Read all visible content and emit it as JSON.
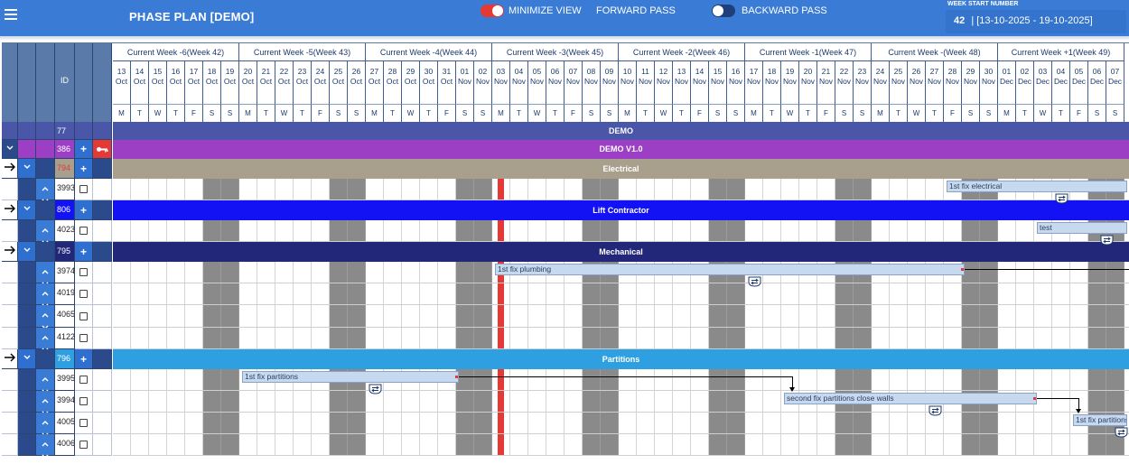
{
  "app": {
    "title": "PHASE PLAN [DEMO]",
    "minimize_label": "MINIMIZE VIEW",
    "forward_label": "FORWARD PASS",
    "backward_label": "BACKWARD PASS",
    "week_start_label": "WEEK START NUMBER",
    "week_number": "42",
    "week_range": "| [13-10-2025 - 19-10-2025]"
  },
  "grid": {
    "id_header": "ID",
    "weeks": [
      {
        "label": "Current Week -6(Week 42)"
      },
      {
        "label": "Current Week -5(Week 43)"
      },
      {
        "label": "Current Week -4(Week 44)"
      },
      {
        "label": "Current Week -3(Week 45)"
      },
      {
        "label": "Current Week -2(Week 46)"
      },
      {
        "label": "Current Week -1(Week 47)"
      },
      {
        "label": "Current Week -(Week 48)"
      },
      {
        "label": "Current Week +1(Week 49)"
      }
    ],
    "days": [
      {
        "d": "13",
        "m": "Oct",
        "w": "M"
      },
      {
        "d": "14",
        "m": "Oct",
        "w": "T"
      },
      {
        "d": "15",
        "m": "Oct",
        "w": "W"
      },
      {
        "d": "16",
        "m": "Oct",
        "w": "T"
      },
      {
        "d": "17",
        "m": "Oct",
        "w": "F"
      },
      {
        "d": "18",
        "m": "Oct",
        "w": "S"
      },
      {
        "d": "19",
        "m": "Oct",
        "w": "S"
      },
      {
        "d": "20",
        "m": "Oct",
        "w": "M"
      },
      {
        "d": "21",
        "m": "Oct",
        "w": "T"
      },
      {
        "d": "22",
        "m": "Oct",
        "w": "W"
      },
      {
        "d": "23",
        "m": "Oct",
        "w": "T"
      },
      {
        "d": "24",
        "m": "Oct",
        "w": "F"
      },
      {
        "d": "25",
        "m": "Oct",
        "w": "S"
      },
      {
        "d": "26",
        "m": "Oct",
        "w": "S"
      },
      {
        "d": "27",
        "m": "Oct",
        "w": "M"
      },
      {
        "d": "28",
        "m": "Oct",
        "w": "T"
      },
      {
        "d": "29",
        "m": "Oct",
        "w": "W"
      },
      {
        "d": "30",
        "m": "Oct",
        "w": "T"
      },
      {
        "d": "31",
        "m": "Oct",
        "w": "F"
      },
      {
        "d": "01",
        "m": "Nov",
        "w": "S"
      },
      {
        "d": "02",
        "m": "Nov",
        "w": "S"
      },
      {
        "d": "03",
        "m": "Nov",
        "w": "M"
      },
      {
        "d": "04",
        "m": "Nov",
        "w": "T"
      },
      {
        "d": "05",
        "m": "Nov",
        "w": "W"
      },
      {
        "d": "06",
        "m": "Nov",
        "w": "T"
      },
      {
        "d": "07",
        "m": "Nov",
        "w": "F"
      },
      {
        "d": "08",
        "m": "Nov",
        "w": "S"
      },
      {
        "d": "09",
        "m": "Nov",
        "w": "S"
      },
      {
        "d": "10",
        "m": "Nov",
        "w": "M"
      },
      {
        "d": "11",
        "m": "Nov",
        "w": "T"
      },
      {
        "d": "12",
        "m": "Nov",
        "w": "W"
      },
      {
        "d": "13",
        "m": "Nov",
        "w": "T"
      },
      {
        "d": "14",
        "m": "Nov",
        "w": "F"
      },
      {
        "d": "15",
        "m": "Nov",
        "w": "S"
      },
      {
        "d": "16",
        "m": "Nov",
        "w": "S"
      },
      {
        "d": "17",
        "m": "Nov",
        "w": "M"
      },
      {
        "d": "18",
        "m": "Nov",
        "w": "T"
      },
      {
        "d": "19",
        "m": "Nov",
        "w": "W"
      },
      {
        "d": "20",
        "m": "Nov",
        "w": "T"
      },
      {
        "d": "21",
        "m": "Nov",
        "w": "F"
      },
      {
        "d": "22",
        "m": "Nov",
        "w": "S"
      },
      {
        "d": "23",
        "m": "Nov",
        "w": "S"
      },
      {
        "d": "24",
        "m": "Nov",
        "w": "M"
      },
      {
        "d": "25",
        "m": "Nov",
        "w": "T"
      },
      {
        "d": "26",
        "m": "Nov",
        "w": "W"
      },
      {
        "d": "27",
        "m": "Nov",
        "w": "T"
      },
      {
        "d": "28",
        "m": "Nov",
        "w": "F"
      },
      {
        "d": "29",
        "m": "Nov",
        "w": "S"
      },
      {
        "d": "30",
        "m": "Nov",
        "w": "S"
      },
      {
        "d": "01",
        "m": "Dec",
        "w": "M"
      },
      {
        "d": "02",
        "m": "Dec",
        "w": "T"
      },
      {
        "d": "03",
        "m": "Dec",
        "w": "W"
      },
      {
        "d": "04",
        "m": "Dec",
        "w": "T"
      },
      {
        "d": "05",
        "m": "Dec",
        "w": "F"
      },
      {
        "d": "06",
        "m": "Dec",
        "w": "S"
      },
      {
        "d": "07",
        "m": "Dec",
        "w": "S"
      }
    ],
    "today_index": 21,
    "rows": [
      {
        "kind": "project",
        "id": "77",
        "label": "DEMO",
        "color": "#4a56a8"
      },
      {
        "kind": "version",
        "id": "386",
        "label": "DEMO V1.0",
        "color": "#9c3fc4"
      },
      {
        "kind": "group",
        "id": "794",
        "label": "Electrical",
        "color": "#a8a08c",
        "id_color": "#e53935"
      },
      {
        "kind": "task",
        "id": "3993"
      },
      {
        "kind": "group",
        "id": "806",
        "label": "Lift Contractor",
        "color": "#1212f5"
      },
      {
        "kind": "task",
        "id": "4023"
      },
      {
        "kind": "group",
        "id": "795",
        "label": "Mechanical",
        "color": "#232779"
      },
      {
        "kind": "task",
        "id": "3974"
      },
      {
        "kind": "task",
        "id": "4019"
      },
      {
        "kind": "task",
        "id": "4065"
      },
      {
        "kind": "task",
        "id": "4122"
      },
      {
        "kind": "group",
        "id": "796",
        "label": "Partitions",
        "color": "#2e9fe0"
      },
      {
        "kind": "task",
        "id": "3995"
      },
      {
        "kind": "task",
        "id": "3994"
      },
      {
        "kind": "task",
        "id": "4005"
      },
      {
        "kind": "task",
        "id": "4006"
      }
    ],
    "tasks": [
      {
        "row": 3,
        "label": "1st fix electrical",
        "start": 46,
        "end": 56
      },
      {
        "row": 5,
        "label": "test",
        "start": 51,
        "end": 56
      },
      {
        "row": 7,
        "label": "1st fix plumbing",
        "start": 21,
        "end": 47
      },
      {
        "row": 12,
        "label": "1st fix partitions",
        "start": 7,
        "end": 19
      },
      {
        "row": 13,
        "label": "second fix partitions close walls",
        "start": 37,
        "end": 51
      },
      {
        "row": 14,
        "label": "1st fix partitions",
        "start": 53,
        "end": 56
      }
    ]
  }
}
